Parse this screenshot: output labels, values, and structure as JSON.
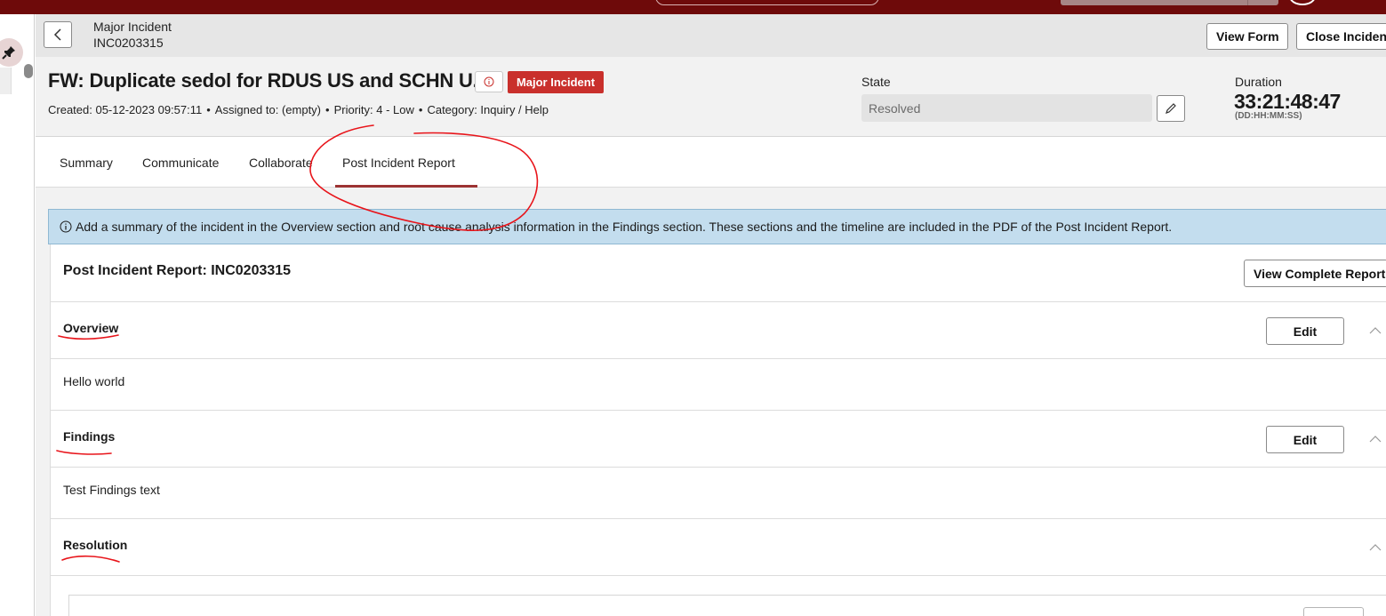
{
  "record_header": {
    "type": "Major Incident",
    "number": "INC0203315",
    "view_form": "View Form",
    "close_incident": "Close Incident"
  },
  "incident": {
    "title": "FW: Duplicate sedol for RDUS US and SCHN U...",
    "badge": "Major Incident",
    "badge_color": "#c9302c",
    "meta": {
      "created": "Created: 05-12-2023 09:57:11",
      "assigned": "Assigned to: (empty)",
      "priority": "Priority: 4 - Low",
      "category": "Category: Inquiry / Help"
    },
    "state_label": "State",
    "state_value": "Resolved",
    "duration_label": "Duration",
    "duration_value": "33:21:48:47",
    "duration_format": "(DD:HH:MM:SS)"
  },
  "tabs": {
    "summary": "Summary",
    "communicate": "Communicate",
    "collaborate": "Collaborate",
    "post_incident_report": "Post Incident Report"
  },
  "notice": {
    "text": "Add a summary of the incident in the Overview section and root cause analysis information in the Findings section. These sections and the timeline are included in the PDF of the Post Incident Report."
  },
  "report": {
    "title": "Post Incident Report: INC0203315",
    "view_complete": "View Complete Report",
    "sections": {
      "overview": {
        "title": "Overview",
        "edit": "Edit",
        "text": "Hello world"
      },
      "findings": {
        "title": "Findings",
        "edit": "Edit",
        "text": "Test Findings text"
      },
      "resolution": {
        "title": "Resolution"
      }
    }
  },
  "colors": {
    "brand_bar": "#6e0a0a",
    "active_tab": "#9c3333",
    "notice_bg": "#c3ddee",
    "annotation": "#e8141a"
  }
}
